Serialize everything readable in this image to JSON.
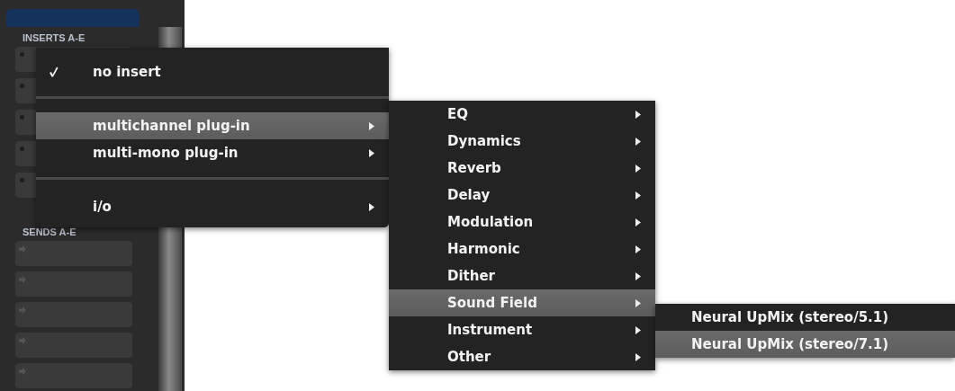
{
  "strip": {
    "inserts_label": "INSERTS A-E",
    "sends_label": "SENDS A-E"
  },
  "menus": [
    {
      "items": [
        {
          "kind": "item",
          "label": "no insert",
          "checked": true,
          "selected": false,
          "submenu": false
        },
        {
          "kind": "separator"
        },
        {
          "kind": "item",
          "label": "multichannel plug-in",
          "checked": false,
          "selected": true,
          "submenu": true
        },
        {
          "kind": "item",
          "label": "multi-mono plug-in",
          "checked": false,
          "selected": false,
          "submenu": true
        },
        {
          "kind": "separator"
        },
        {
          "kind": "item",
          "label": "i/o",
          "checked": false,
          "selected": false,
          "submenu": true
        }
      ]
    },
    {
      "items": [
        {
          "kind": "item",
          "label": "EQ",
          "checked": false,
          "selected": false,
          "submenu": true
        },
        {
          "kind": "item",
          "label": "Dynamics",
          "checked": false,
          "selected": false,
          "submenu": true
        },
        {
          "kind": "item",
          "label": "Reverb",
          "checked": false,
          "selected": false,
          "submenu": true
        },
        {
          "kind": "item",
          "label": "Delay",
          "checked": false,
          "selected": false,
          "submenu": true
        },
        {
          "kind": "item",
          "label": "Modulation",
          "checked": false,
          "selected": false,
          "submenu": true
        },
        {
          "kind": "item",
          "label": "Harmonic",
          "checked": false,
          "selected": false,
          "submenu": true
        },
        {
          "kind": "item",
          "label": "Dither",
          "checked": false,
          "selected": false,
          "submenu": true
        },
        {
          "kind": "item",
          "label": "Sound Field",
          "checked": false,
          "selected": true,
          "submenu": true
        },
        {
          "kind": "item",
          "label": "Instrument",
          "checked": false,
          "selected": false,
          "submenu": true
        },
        {
          "kind": "item",
          "label": "Other",
          "checked": false,
          "selected": false,
          "submenu": true
        }
      ]
    },
    {
      "items": [
        {
          "kind": "item",
          "label": "Neural UpMix (stereo/5.1)",
          "checked": false,
          "selected": false,
          "submenu": false
        },
        {
          "kind": "item",
          "label": "Neural UpMix (stereo/7.1)",
          "checked": false,
          "selected": true,
          "submenu": false
        }
      ]
    }
  ]
}
